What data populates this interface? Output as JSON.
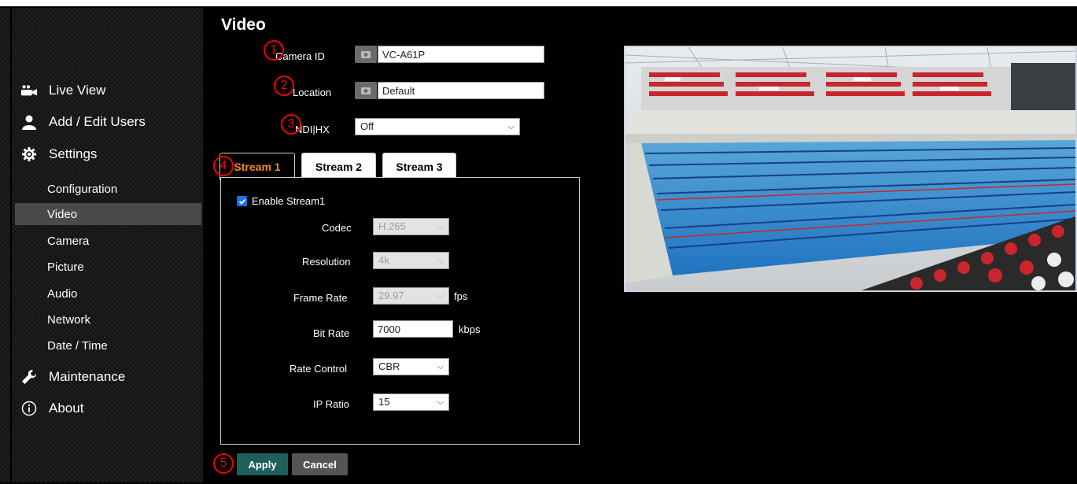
{
  "page": {
    "title": "Video"
  },
  "sidebar": {
    "main_items": [
      {
        "label": "Live View",
        "icon": "people-camera-icon"
      },
      {
        "label": "Add / Edit Users",
        "icon": "user-icon"
      },
      {
        "label": "Settings",
        "icon": "gear-icon"
      },
      {
        "label": "Maintenance",
        "icon": "wrench-icon"
      },
      {
        "label": "About",
        "icon": "info-icon"
      }
    ],
    "settings_items": [
      {
        "label": "Configuration"
      },
      {
        "label": "Video",
        "active": true
      },
      {
        "label": "Camera"
      },
      {
        "label": "Picture"
      },
      {
        "label": "Audio"
      },
      {
        "label": "Network"
      },
      {
        "label": "Date / Time"
      }
    ]
  },
  "form": {
    "camera_id": {
      "label": "Camera ID",
      "value": "VC-A61P"
    },
    "location": {
      "label": "Location",
      "value": "Default"
    },
    "ndi": {
      "label": "NDI|HX",
      "value": "Off"
    }
  },
  "tabs": [
    {
      "label": "Stream 1",
      "active": true
    },
    {
      "label": "Stream 2"
    },
    {
      "label": "Stream 3"
    }
  ],
  "stream": {
    "enable_label": "Enable Stream1",
    "enabled": true,
    "codec": {
      "label": "Codec",
      "value": "H.265",
      "disabled": true
    },
    "resolution": {
      "label": "Resolution",
      "value": "4k",
      "disabled": true
    },
    "frame_rate": {
      "label": "Frame Rate",
      "value": "29.97",
      "unit": "fps",
      "disabled": true
    },
    "bit_rate": {
      "label": "Bit Rate",
      "value": "7000",
      "unit": "kbps"
    },
    "rate_control": {
      "label": "Rate Control",
      "value": "CBR"
    },
    "ip_ratio": {
      "label": "IP Ratio",
      "value": "15"
    }
  },
  "buttons": {
    "apply": "Apply",
    "cancel": "Cancel"
  },
  "markers": [
    "1",
    "2",
    "3",
    "4",
    "5"
  ],
  "colors": {
    "active_tab_text": "#f08a24",
    "apply_button": "#1f5f5a",
    "cancel_button": "#555555",
    "marker": "#e00000"
  }
}
